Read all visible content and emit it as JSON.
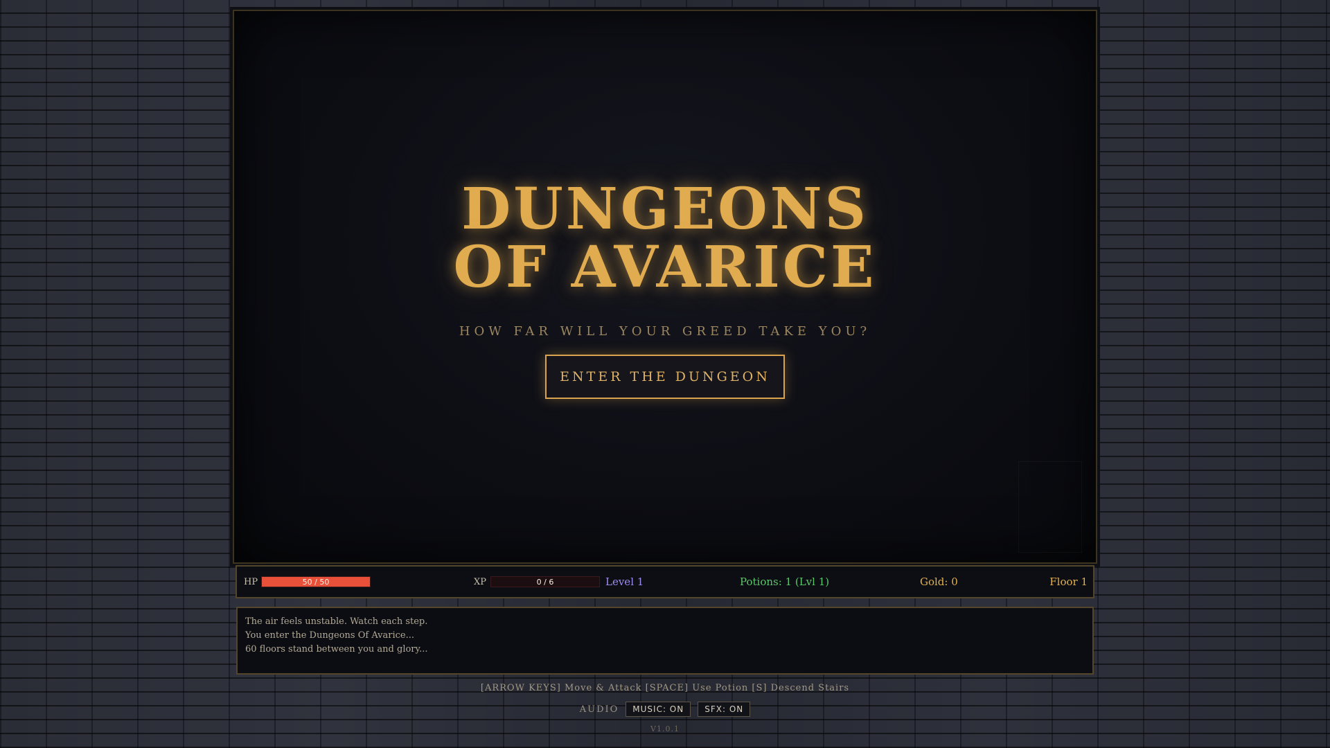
{
  "title": {
    "line1": "DUNGEONS",
    "line2": "OF AVARICE",
    "subtitle": "HOW FAR WILL YOUR GREED TAKE YOU?",
    "enter_button": "ENTER THE DUNGEON"
  },
  "status": {
    "hp_label": "HP",
    "hp_text": "50 / 50",
    "hp_fraction": 1.0,
    "xp_label": "XP",
    "xp_text": "0 / 6",
    "xp_fraction": 0.0,
    "level": "Level 1",
    "potions": "Potions: 1 (Lvl 1)",
    "gold": "Gold: 0",
    "floor": "Floor 1"
  },
  "log": [
    "The air feels unstable. Watch each step.",
    "You enter the Dungeons Of Avarice...",
    "60 floors stand between you and glory..."
  ],
  "help": {
    "text": "[ARROW KEYS] Move & Attack   [SPACE] Use Potion   [S] Descend Stairs"
  },
  "audio": {
    "label": "AUDIO",
    "music": "MUSIC: ON",
    "sfx": "SFX: ON"
  },
  "version": "V1.0.1",
  "colors": {
    "accent_gold": "#e1ab4f",
    "hp_bar": "#e8503a",
    "level": "#9e8cf0",
    "potions": "#5cc86b"
  }
}
